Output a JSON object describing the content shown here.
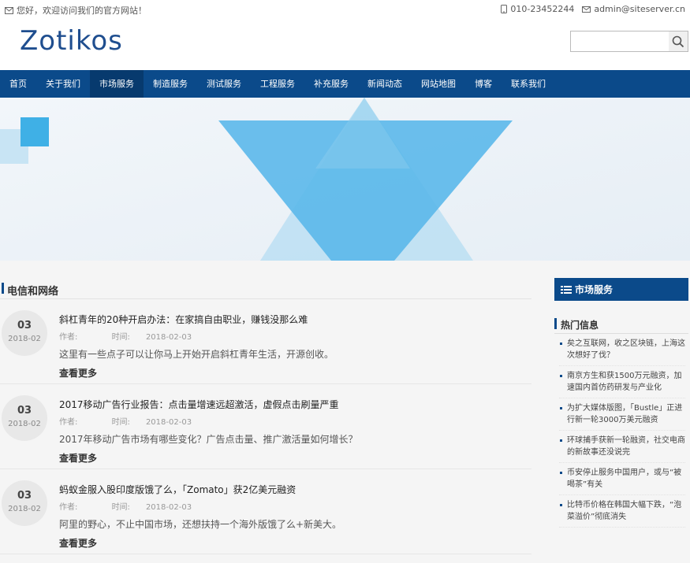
{
  "topbar": {
    "welcome": "您好，欢迎访问我们的官方网站！",
    "phone": "010-23452244",
    "email": "admin@siteserver.cn"
  },
  "header": {
    "logo": "Zotikos",
    "search_placeholder": ""
  },
  "nav": {
    "items": [
      "首页",
      "关于我们",
      "市场服务",
      "制造服务",
      "测试服务",
      "工程服务",
      "补充服务",
      "新闻动态",
      "网站地图",
      "博客",
      "联系我们"
    ],
    "active": "市场服务"
  },
  "section": {
    "title": "电信和网络",
    "more_label": "查看更多",
    "author_label": "作者:",
    "time_label": "时间:",
    "articles": [
      {
        "day": "03",
        "yearmonth": "2018-02",
        "title": "斜杠青年的20种开启办法：在家搞自由职业，赚钱没那么难",
        "author": "",
        "time": "2018-02-03",
        "summary": "这里有一些点子可以让你马上开始开启斜杠青年生活，开源创收。"
      },
      {
        "day": "03",
        "yearmonth": "2018-02",
        "title": "2017移动广告行业报告：点击量增速远超激活，虚假点击刷量严重",
        "author": "",
        "time": "2018-02-03",
        "summary": "2017年移动广告市场有哪些变化？广告点击量、推广激活量如何增长？"
      },
      {
        "day": "03",
        "yearmonth": "2018-02",
        "title": "蚂蚁金服入股印度版饿了么，「Zomato」获2亿美元融资",
        "author": "",
        "time": "2018-02-03",
        "summary": "阿里的野心，不止中国市场，还想扶持一个海外版饿了么+新美大。"
      }
    ]
  },
  "sidebar": {
    "header": "市场服务",
    "hot_title": "热门信息",
    "hot_items": [
      "矣之互联网，收之区块链，上海这次想好了伐？",
      "南京方生和获1500万元融资，加速国内首仿药研发与产业化",
      "为扩大媒体版图，「Bustle」正进行新一轮3000万美元融资",
      "环球捕手获新一轮融资，社交电商的新故事还没说完",
      "币安停止服务中国用户，或与“被喝茶”有关",
      "比特币价格在韩国大幅下跌，“泡菜溢价”彻底消失"
    ]
  },
  "colors": {
    "nav_bg": "#0b4a8a",
    "nav_active": "#073a6e",
    "logo": "#1f4e8f",
    "banner_triangle": "#5bb8ea"
  }
}
